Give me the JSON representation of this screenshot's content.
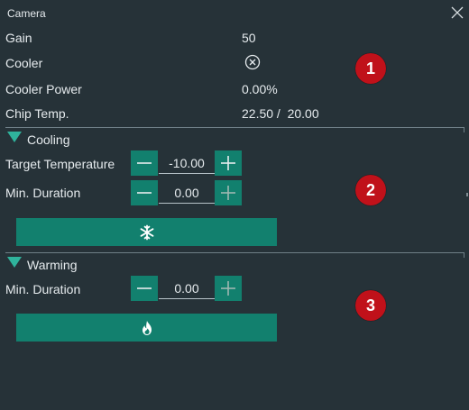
{
  "window": {
    "title": "Camera"
  },
  "status": {
    "gain_label": "Gain",
    "gain_value": "50",
    "cooler_label": "Cooler",
    "cooler_power_label": "Cooler Power",
    "cooler_power_value": "0.00%",
    "chip_temp_label": "Chip Temp.",
    "chip_temp_value": "22.50 /  20.00"
  },
  "cooling": {
    "title": "Cooling",
    "target_temp_label": "Target Temperature",
    "target_temp_value": "-10.00",
    "min_duration_label": "Min. Duration",
    "min_duration_value": "0.00"
  },
  "warming": {
    "title": "Warming",
    "min_duration_label": "Min. Duration",
    "min_duration_value": "0.00"
  },
  "badges": [
    "1",
    "2",
    "3"
  ],
  "colors": {
    "background": "#263238",
    "accent": "#12806e",
    "badge": "#c0111a",
    "triangle": "#2fb39c"
  },
  "icons": {
    "close": "close-icon",
    "cooler_state": "circle-x-icon",
    "cool_action": "snowflake-icon",
    "warm_action": "flame-icon",
    "decrement": "minus-icon",
    "increment": "plus-icon",
    "expander": "triangle-down-icon"
  }
}
